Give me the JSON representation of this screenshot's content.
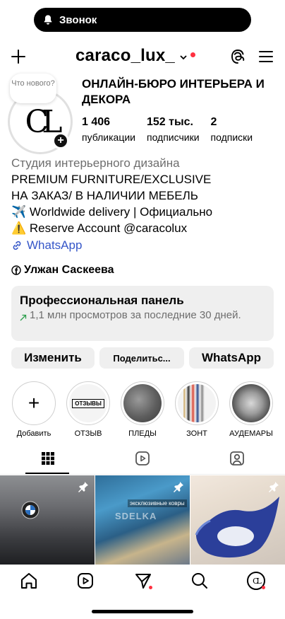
{
  "status": {
    "call_label": "Звонок"
  },
  "header": {
    "username": "caraco_lux_"
  },
  "profile": {
    "note": "Что нового?",
    "avatar_letters": "CL",
    "full_name": "ОНЛАЙН-БЮРО ИНТЕРЬЕРА И ДЕКОРА",
    "stats": [
      {
        "value": "1 406",
        "label": "публикации"
      },
      {
        "value": "152 тыс.",
        "label": "подписчики"
      },
      {
        "value": "2",
        "label": "подписки"
      }
    ]
  },
  "bio": {
    "category": "Студия интерьерного дизайна",
    "line1": "PREMIUM FURNITURE/EXCLUSIVE",
    "line2": "НА ЗАКАЗ/ В НАЛИЧИИ МЕБЕЛЬ",
    "line3": "✈️ Worldwide delivery | Официально",
    "line4": "⚠️ Reserve Account @caracolux",
    "link": "WhatsApp",
    "facebook_name": "Улжан Саскеева"
  },
  "pro_panel": {
    "title": "Профессиональная панель",
    "subtitle": "1,1 млн просмотров за последние 30 дней."
  },
  "actions": {
    "edit": "Изменить",
    "share": "Поделитьс...",
    "whatsapp": "WhatsApp"
  },
  "highlights": [
    {
      "label": "Добавить"
    },
    {
      "label": "ОТЗЫВ",
      "cover_text": "ОТЗЫВЫ"
    },
    {
      "label": "ПЛЕДЫ"
    },
    {
      "label": "ЗОНТ"
    },
    {
      "label": "АУДЕМАРЫ"
    }
  ],
  "grid": {
    "post2_caption": "эксклюзивные ковры",
    "post2_watermark": "SDELKA"
  },
  "colors": {
    "accent_link": "#3556c8",
    "notification_red": "#ff3040",
    "panel_bg": "#efefef"
  }
}
